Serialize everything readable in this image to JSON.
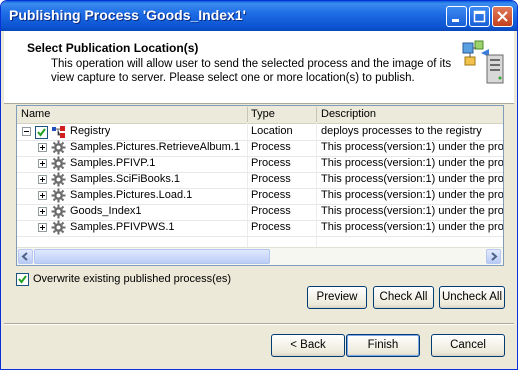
{
  "window": {
    "title": "Publishing Process 'Goods_Index1'"
  },
  "header": {
    "title": "Select Publication Location(s)",
    "description": "This operation will allow user to send the selected process and the image of its view capture to server. Please select one or more location(s) to publish."
  },
  "table": {
    "columns": [
      "Name",
      "Type",
      "Description"
    ],
    "root": {
      "name": "Registry",
      "type": "Location",
      "description": "deploys processes to the registry",
      "checked": true
    },
    "rows": [
      {
        "name": "Samples.Pictures.RetrieveAlbum.1",
        "type": "Process",
        "description": "This process(version:1) under the proje"
      },
      {
        "name": "Samples.PFIVP.1",
        "type": "Process",
        "description": "This process(version:1) under the proje"
      },
      {
        "name": "Samples.SciFiBooks.1",
        "type": "Process",
        "description": "This process(version:1) under the proje"
      },
      {
        "name": "Samples.Pictures.Load.1",
        "type": "Process",
        "description": "This process(version:1) under the proje"
      },
      {
        "name": "Goods_Index1",
        "type": "Process",
        "description": "This process(version:1) under the proje"
      },
      {
        "name": "Samples.PFIVPWS.1",
        "type": "Process",
        "description": "This process(version:1) under the proje"
      }
    ]
  },
  "options": {
    "overwrite_label": "Overwrite existing published process(es)",
    "overwrite_checked": true
  },
  "buttons": {
    "preview": "Preview",
    "check_all": "Check All",
    "uncheck_all": "Uncheck All",
    "back": "< Back",
    "finish": "Finish",
    "cancel": "Cancel"
  },
  "colors": {
    "title_bar": "#0a5fd8",
    "dialog_face": "#ece9d8",
    "button_border": "#003c74"
  }
}
